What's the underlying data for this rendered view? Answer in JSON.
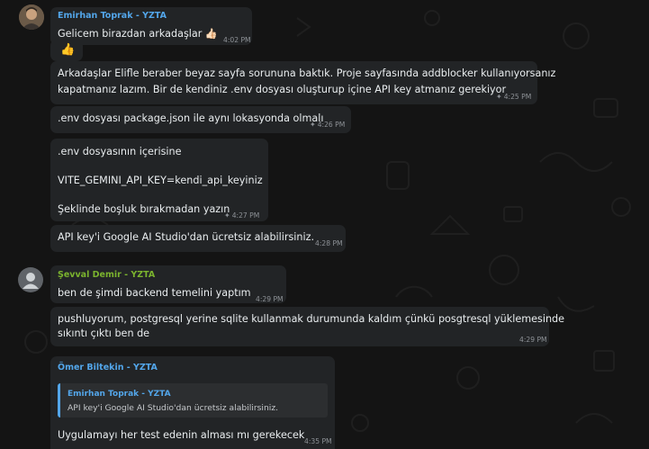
{
  "colors": {
    "background": "#141414",
    "bubble": "#222426",
    "sender_blue": "#53a6ea",
    "sender_green": "#7bb32e",
    "timestamp": "#8e9297"
  },
  "messages": [
    {
      "sender": "Emirhan Toprak - YZTA",
      "text": "Gelicem birazdan arkadaşlar 👍🏻",
      "time": "4:02 PM"
    },
    {
      "reaction": "👍"
    },
    {
      "line1": "Arkadaşlar Elifle beraber beyaz sayfa sorununa baktık. Proje sayfasında addblocker kullanıyorsanız",
      "line2": "kapatmanız lazım. Bir de kendiniz .env dosyası oluşturup içine API key atmanız gerekiyor",
      "time": "4:25 PM"
    },
    {
      "text": ".env dosyası package.json ile aynı lokasyonda olmalı",
      "time": "4:26 PM"
    },
    {
      "line1": ".env dosyasının içerisine",
      "line2": "VITE_GEMINI_API_KEY=kendi_api_keyiniz",
      "line3": "Şeklinde boşluk bırakmadan yazın",
      "time": "4:27 PM"
    },
    {
      "text": "API key'i Google AI Studio'dan ücretsiz alabilirsiniz.",
      "time": "4:28 PM"
    },
    {
      "sender": "Şevval Demir - YZTA",
      "text": "ben de şimdi backend temelini yaptım",
      "time": "4:29 PM"
    },
    {
      "line1": "pushluyorum, postgresql yerine sqlite kullanmak durumunda kaldım çünkü posgtresql yüklemesinde",
      "line2": "sıkıntı çıktı ben de",
      "time": "4:29 PM"
    },
    {
      "sender": "Ömer Biltekin - YZTA",
      "quote_sender": "Emirhan Toprak - YZTA",
      "quote_text": "API key'i Google AI Studio'dan ücretsiz alabilirsiniz.",
      "text": "Uygulamayı her test edenin alması mı gerekecek",
      "time": "4:35 PM"
    }
  ]
}
